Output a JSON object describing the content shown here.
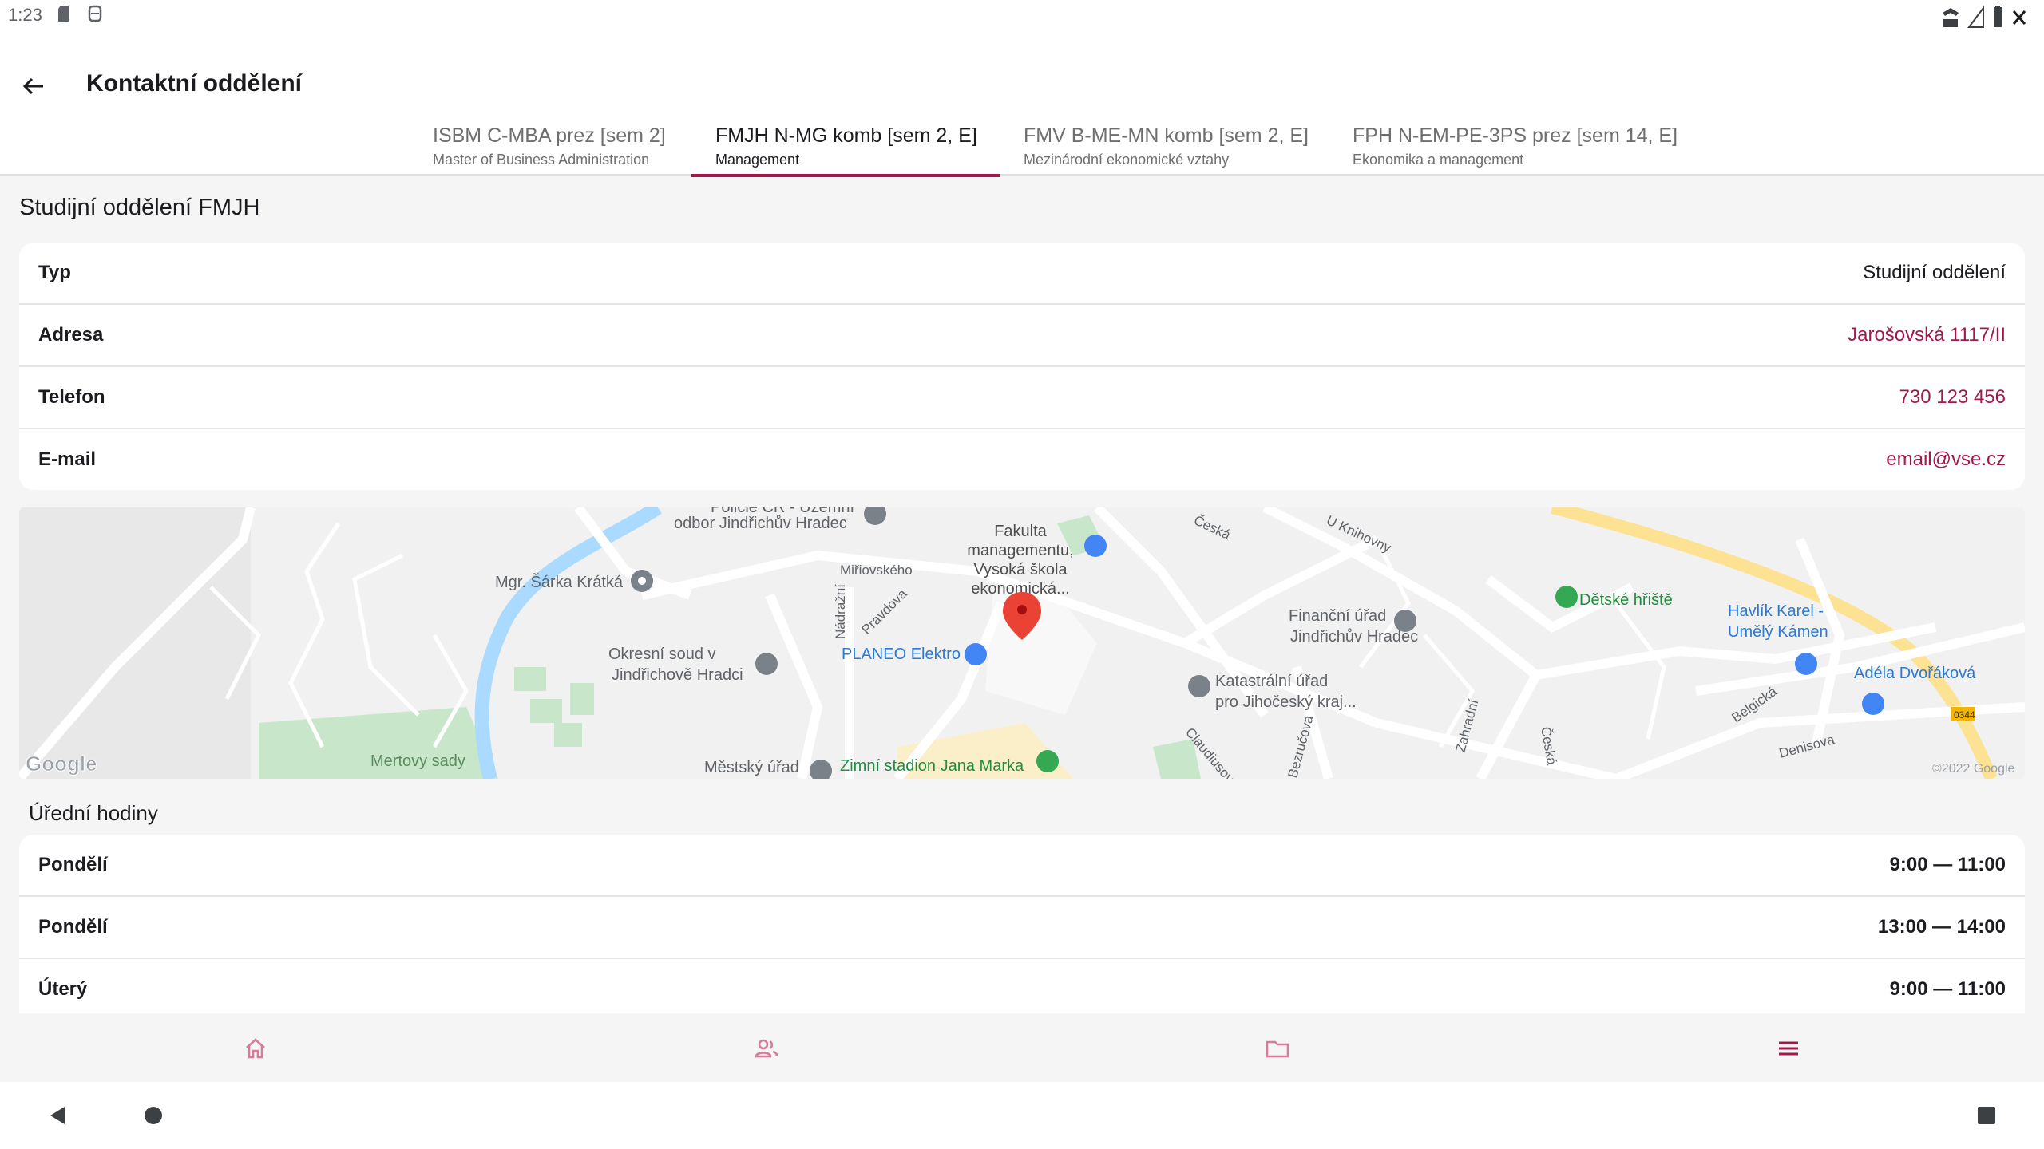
{
  "status_bar": {
    "time": "1:23"
  },
  "app_bar": {
    "title": "Kontaktní oddělení"
  },
  "tabs": [
    {
      "label": "ISBM C-MBA prez [sem 2]",
      "sublabel": "Master of Business Administration",
      "active": false
    },
    {
      "label": "FMJH N-MG komb [sem 2, E]",
      "sublabel": "Management",
      "active": true
    },
    {
      "label": "FMV B-ME-MN komb [sem 2, E]",
      "sublabel": "Mezinárodní ekonomické vztahy",
      "active": false
    },
    {
      "label": "FPH N-EM-PE-3PS prez [sem 14, E]",
      "sublabel": "Ekonomika a management",
      "active": false
    }
  ],
  "department": {
    "title": "Studijní oddělení FMJH",
    "rows": [
      {
        "label": "Typ",
        "value": "Studijní oddělení"
      },
      {
        "label": "Adresa",
        "value": "Jarošovská 1117/II"
      },
      {
        "label": "Telefon",
        "value": "730 123 456"
      },
      {
        "label": "E-mail",
        "value": "email@vse.cz"
      }
    ]
  },
  "map": {
    "labels": {
      "police": "odbor Jindřichův Hradec",
      "police_top": "Policie ČR - Územní",
      "sarka": "Mgr. Šárka Krátká",
      "mirovskeho": "Miřiovského",
      "nadrazni": "Nádražní",
      "pravdova": "Pravdova",
      "fakulta1": "Fakulta",
      "fakulta2": "managementu,",
      "fakulta3": "Vysoká škola",
      "fakulta4": "ekonomická...",
      "ceska": "Česká",
      "knihovny": "U Knihovny",
      "financni1": "Finanční úřad",
      "financni2": "Jindřichův Hradec",
      "detske": "Dětské hřiště",
      "havlik1": "Havlík Karel -",
      "havlik2": "Umělý Kámen",
      "adela": "Adéla Dvořáková",
      "soud1": "Okresní soud v",
      "soud2": "Jindřichově Hradci",
      "planeo": "PLANEO Elektro",
      "katastr1": "Katastrální úřad",
      "katastr2": "pro Jihočeský kraj...",
      "claudius": "Claudiusova",
      "bezrucova": "Bezručova",
      "zahradni": "Zahradní",
      "ceska2": "Česká",
      "belgicka": "Belgická",
      "denisova": "Denisova",
      "mertovy": "Mertovy sady",
      "mestsky": "Městský úřad",
      "stadion": "Zimní stadion Jana Marka",
      "road_num": "0344",
      "google": "Google",
      "copyright": "©2022 Google"
    }
  },
  "office_hours": {
    "title": "Úřední hodiny",
    "rows": [
      {
        "day": "Pondělí",
        "time": "9:00 — 11:00"
      },
      {
        "day": "Pondělí",
        "time": "13:00 — 14:00"
      },
      {
        "day": "Úterý",
        "time": "9:00 — 11:00"
      }
    ]
  },
  "bottom_nav": [
    {
      "icon": "home-icon"
    },
    {
      "icon": "people-icon"
    },
    {
      "icon": "folder-icon"
    },
    {
      "icon": "menu-icon",
      "active": true
    }
  ],
  "colors": {
    "accent": "#a3174b",
    "inactive_nav": "#d77a9c"
  }
}
